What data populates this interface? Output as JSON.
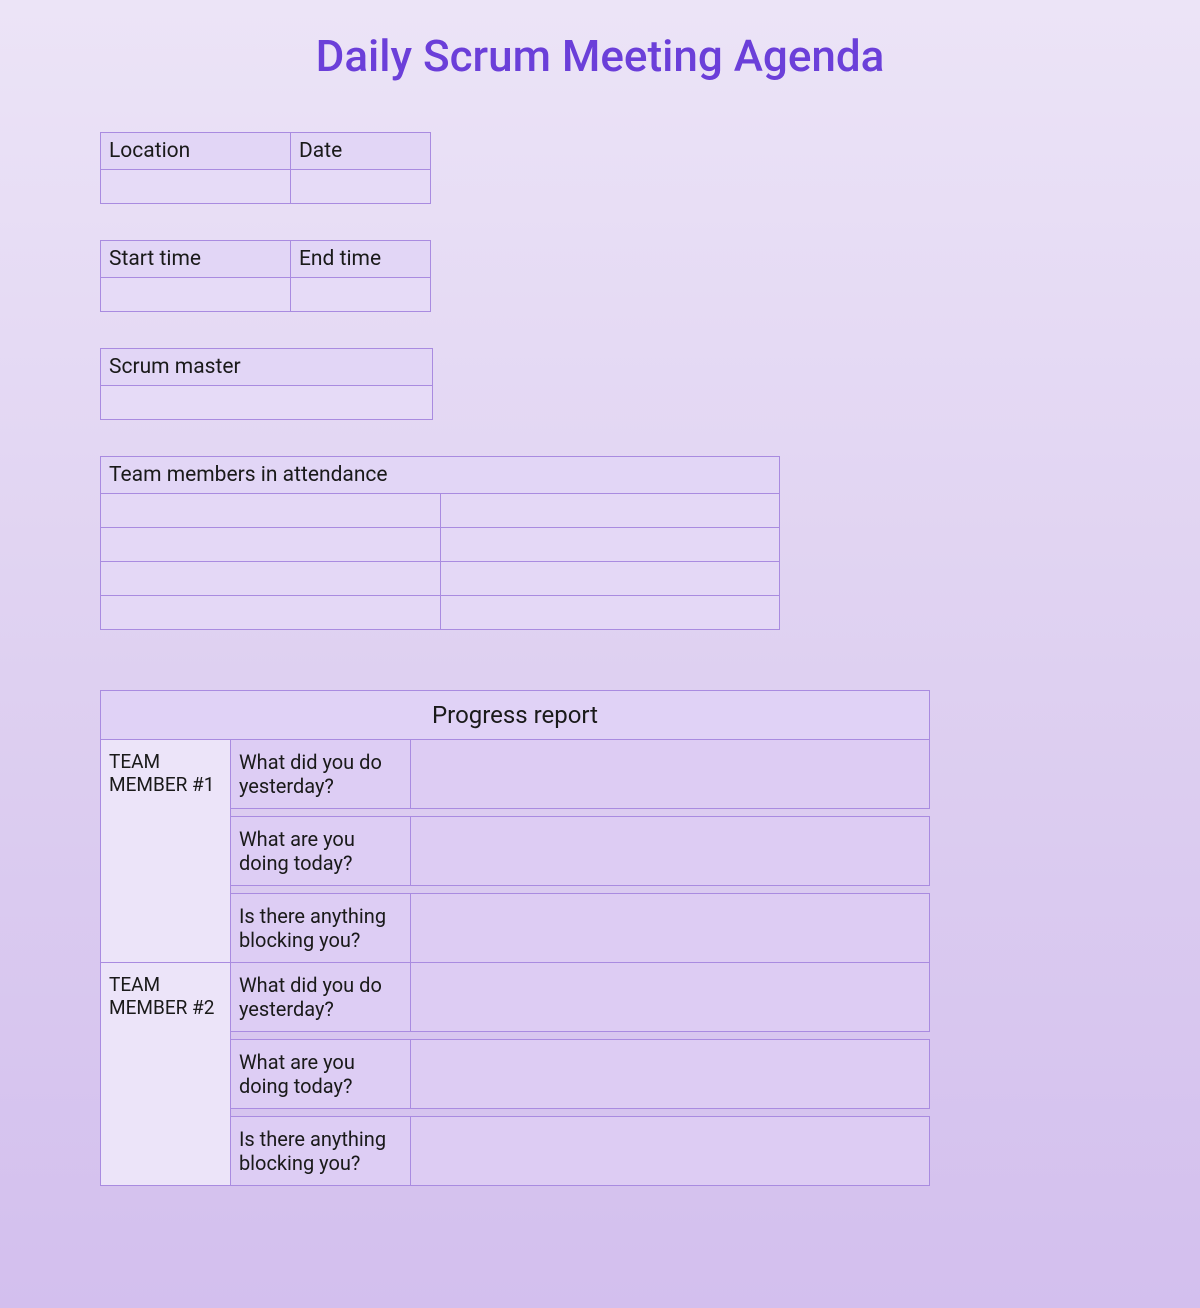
{
  "title": "Daily Scrum Meeting Agenda",
  "info": {
    "location_label": "Location",
    "date_label": "Date",
    "start_label": "Start time",
    "end_label": "End time",
    "scrum_master_label": "Scrum master",
    "location_value": "",
    "date_value": "",
    "start_value": "",
    "end_value": "",
    "scrum_master_value": ""
  },
  "attendance": {
    "header": "Team members in attendance",
    "rows": [
      [
        "",
        ""
      ],
      [
        "",
        ""
      ],
      [
        "",
        ""
      ],
      [
        "",
        ""
      ]
    ]
  },
  "progress": {
    "title": "Progress report",
    "questions": [
      "What did you do yesterday?",
      "What are you doing today?",
      "Is there anything blocking you?"
    ],
    "members": [
      {
        "label": "TEAM MEMBER #1",
        "answers": [
          "",
          "",
          ""
        ]
      },
      {
        "label": "TEAM MEMBER #2",
        "answers": [
          "",
          "",
          ""
        ]
      }
    ]
  }
}
